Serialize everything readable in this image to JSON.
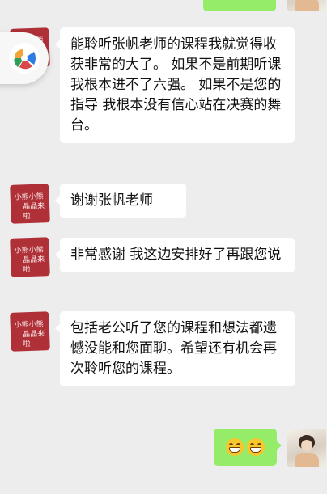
{
  "messages": [
    {
      "sender": "self",
      "text": "",
      "note": "partially visible sent message at top edge"
    },
    {
      "sender": "other",
      "text": "能聆听张帆老师的课程我就觉得收获非常的大了。 如果不是前期听课 我根本进不了六强。 如果不是您的指导 我根本没有信心站在决赛的舞台。"
    },
    {
      "sender": "other",
      "text": "谢谢张帆老师"
    },
    {
      "sender": "other",
      "text": "非常感谢 我这边安排好了再跟您说"
    },
    {
      "sender": "other",
      "text": "包括老公听了您的课程和想法都遗憾没能和您面聊。希望还有机会再次聆听您的课程。"
    },
    {
      "sender": "self",
      "emoji": [
        "grinning-face",
        "grinning-face"
      ]
    }
  ],
  "avatar_other_text": [
    "小熊小熊",
    "晶晶来啦"
  ],
  "colors": {
    "background": "#ededed",
    "bubble_other": "#ffffff",
    "bubble_self": "#95ec69",
    "avatar_other": "#b03038"
  }
}
